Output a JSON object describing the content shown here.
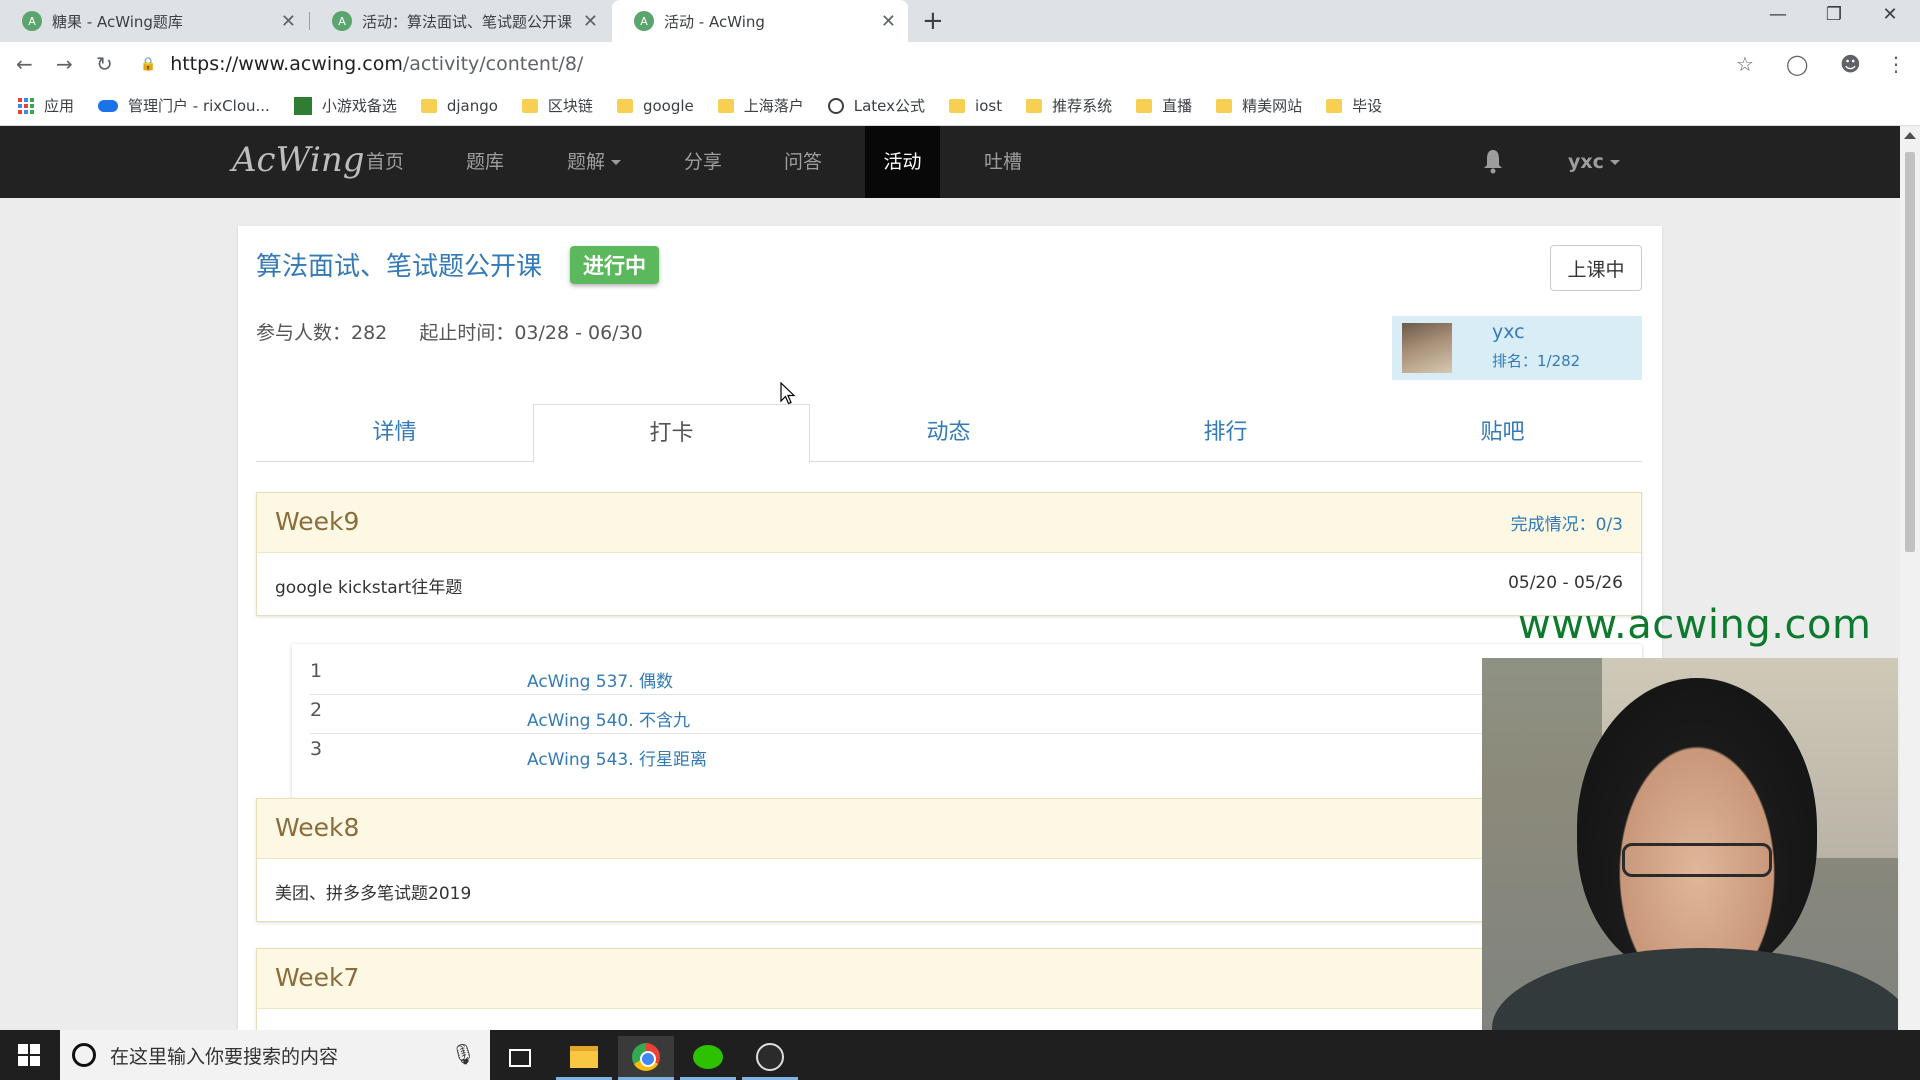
{
  "browser": {
    "tabs": [
      {
        "title": "糖果 - AcWing题库"
      },
      {
        "title": "活动：算法面试、笔试题公开课"
      },
      {
        "title": "活动 - AcWing"
      }
    ],
    "url_host": "https://www.acwing.com",
    "url_path": "/activity/content/8/",
    "bookmarks": [
      {
        "label": "应用",
        "icon": "apps-icon"
      },
      {
        "label": "管理门户 - rixClou...",
        "icon": "cloud-icon"
      },
      {
        "label": "小游戏备选",
        "icon": "grid-icon"
      },
      {
        "label": "django",
        "icon": "folder-icon"
      },
      {
        "label": "区块链",
        "icon": "folder-icon"
      },
      {
        "label": "google",
        "icon": "folder-icon"
      },
      {
        "label": "上海落户",
        "icon": "folder-icon"
      },
      {
        "label": "Latex公式",
        "icon": "globe-icon"
      },
      {
        "label": "iost",
        "icon": "folder-icon"
      },
      {
        "label": "推荐系统",
        "icon": "folder-icon"
      },
      {
        "label": "直播",
        "icon": "folder-icon"
      },
      {
        "label": "精美网站",
        "icon": "folder-icon"
      },
      {
        "label": "毕设",
        "icon": "folder-icon"
      }
    ]
  },
  "site": {
    "logo": "AcWing",
    "nav": [
      "首页",
      "题库",
      "题解",
      "分享",
      "问答",
      "活动",
      "吐槽"
    ],
    "active_nav": "活动",
    "username": "yxc"
  },
  "activity": {
    "title": "算法面试、笔试题公开课",
    "badge": "进行中",
    "status_button": "上课中",
    "participants": "参与人数：282",
    "period": "起止时间：03/28 - 06/30",
    "user": {
      "name": "yxc",
      "rank": "排名：1/282"
    },
    "tabs": [
      "详情",
      "打卡",
      "动态",
      "排行",
      "贴吧"
    ],
    "active_tab": "打卡"
  },
  "weeks": [
    {
      "title": "Week9",
      "progress": "完成情况：0/3",
      "desc": "google kickstart往年题",
      "date": "05/20 - 05/26",
      "problems": [
        {
          "num": "1",
          "name": "AcWing 537. 偶数"
        },
        {
          "num": "2",
          "name": "AcWing 540. 不含九"
        },
        {
          "num": "3",
          "name": "AcWing 543. 行星距离"
        }
      ]
    },
    {
      "title": "Week8",
      "desc": "美团、拼多多笔试题2019"
    },
    {
      "title": "Week7"
    }
  ],
  "overlay": {
    "watermark": "www.acwing.com"
  },
  "taskbar": {
    "search_placeholder": "在这里输入你要搜索的内容"
  },
  "colors": {
    "link": "#337ab7",
    "badge": "#5cb85c",
    "week_header": "#fcf8e3",
    "navbar": "#222222"
  }
}
